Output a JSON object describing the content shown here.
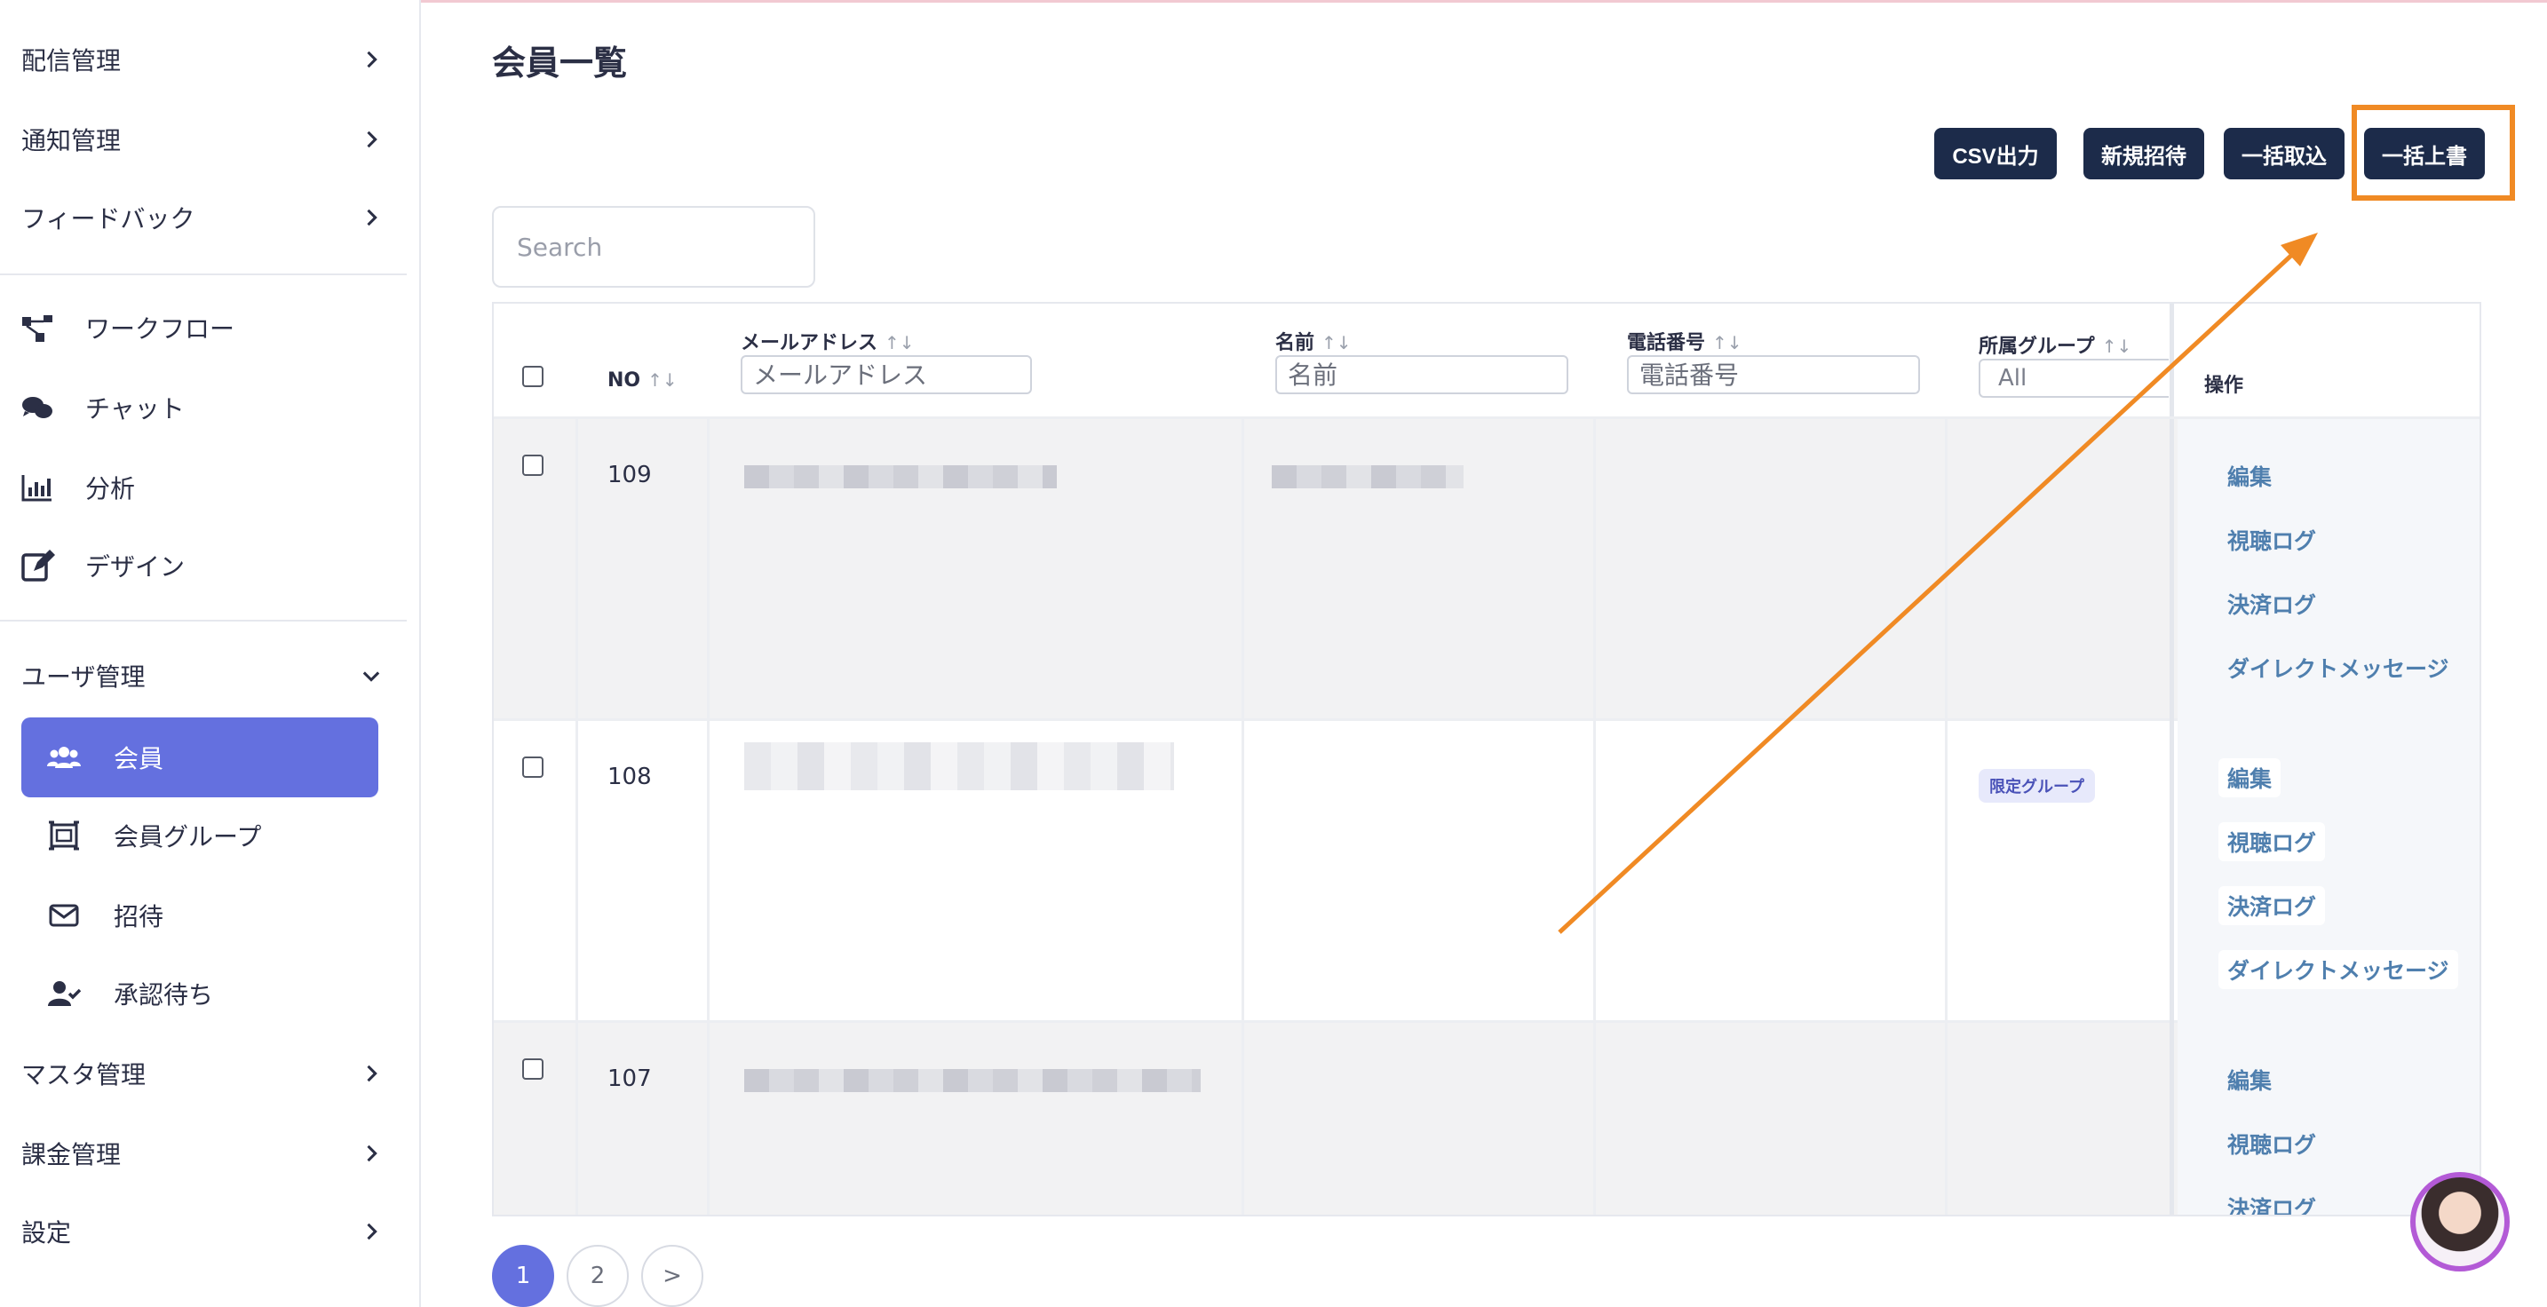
{
  "sidebar": {
    "top_items": [
      {
        "label": "配信管理"
      },
      {
        "label": "通知管理"
      },
      {
        "label": "フィードバック"
      }
    ],
    "icon_items": [
      {
        "label": "ワークフロー",
        "icon": "workflow-icon"
      },
      {
        "label": "チャット",
        "icon": "chat-icon"
      },
      {
        "label": "分析",
        "icon": "chart-icon"
      },
      {
        "label": "デザイン",
        "icon": "edit-icon"
      }
    ],
    "user_mgmt": {
      "label": "ユーザ管理"
    },
    "user_sub": [
      {
        "label": "会員",
        "icon": "users-icon",
        "active": true
      },
      {
        "label": "会員グループ",
        "icon": "group-frame-icon"
      },
      {
        "label": "招待",
        "icon": "envelope-icon"
      },
      {
        "label": "承認待ち",
        "icon": "user-check-icon"
      }
    ],
    "bottom_items": [
      {
        "label": "マスタ管理"
      },
      {
        "label": "課金管理"
      },
      {
        "label": "設定"
      }
    ]
  },
  "page": {
    "title": "会員一覧"
  },
  "toolbar": {
    "csv_label": "CSV出力",
    "invite_label": "新規招待",
    "import_label": "一括取込",
    "overwrite_label": "一括上書"
  },
  "search": {
    "placeholder": "Search"
  },
  "table": {
    "columns": {
      "no": "NO",
      "email": "メールアドレス",
      "name": "名前",
      "phone": "電話番号",
      "group": "所属グループ",
      "ops": "操作"
    },
    "filters": {
      "email_placeholder": "メールアドレス",
      "name_placeholder": "名前",
      "phone_placeholder": "電話番号",
      "group_value": "All"
    },
    "sort_glyph": "↑↓",
    "rows": [
      {
        "no": "109",
        "group": ""
      },
      {
        "no": "108",
        "group": "限定グループ"
      },
      {
        "no": "107",
        "group": ""
      }
    ],
    "actions": {
      "edit": "編集",
      "view_log": "視聴ログ",
      "payment_log": "決済ログ",
      "dm": "ダイレクトメッセージ"
    }
  },
  "pagination": {
    "page1": "1",
    "page2": "2",
    "next": ">"
  },
  "colors": {
    "accent": "#6470df",
    "button": "#1c2b4a",
    "highlight": "#f08a24"
  }
}
